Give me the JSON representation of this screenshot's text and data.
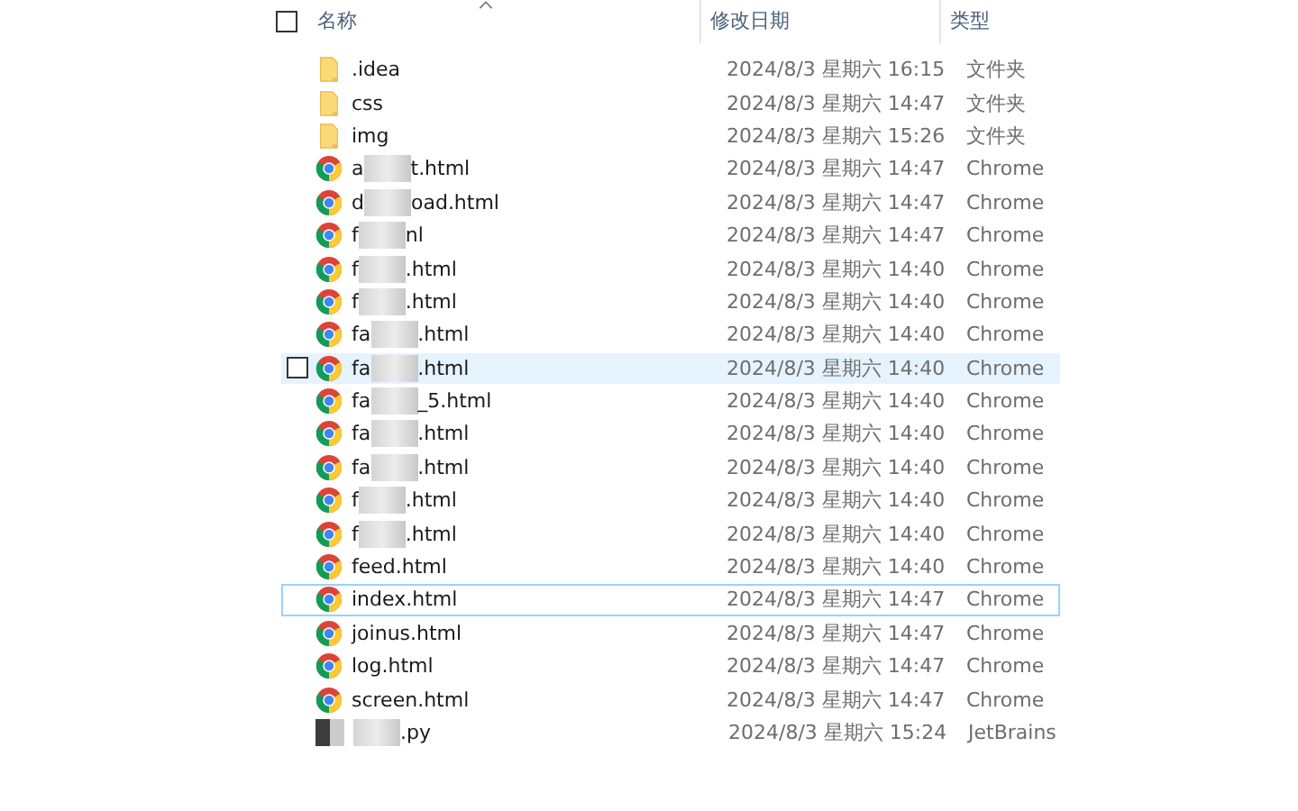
{
  "columns": [
    {
      "label": "名称"
    },
    {
      "label": "修改日期"
    },
    {
      "label": "类型"
    }
  ],
  "header_checked": false,
  "rows": [
    {
      "kind": "folder",
      "name": ".idea",
      "date": "2024/8/3 星期六 16:15",
      "type": "文件夹",
      "hovered": false,
      "focused": false
    },
    {
      "kind": "folder",
      "name": "css",
      "date": "2024/8/3 星期六 14:47",
      "type": "文件夹",
      "hovered": false,
      "focused": false
    },
    {
      "kind": "folder",
      "name": "img",
      "date": "2024/8/3 星期六 15:26",
      "type": "文件夹",
      "hovered": false,
      "focused": false
    },
    {
      "kind": "chrome",
      "name_start": "a",
      "name_end": "t.html",
      "date": "2024/8/3 星期六 14:47",
      "type": "Chrome",
      "hovered": false,
      "focused": false
    },
    {
      "kind": "chrome",
      "name_start": "d",
      "name_end": "oad.html",
      "date": "2024/8/3 星期六 14:47",
      "type": "Chrome",
      "hovered": false,
      "focused": false
    },
    {
      "kind": "chrome",
      "name_start": "f",
      "name_end": "nl",
      "date": "2024/8/3 星期六 14:47",
      "type": "Chrome",
      "hovered": false,
      "focused": false
    },
    {
      "kind": "chrome",
      "name_start": "f",
      "name_end": ".html",
      "date": "2024/8/3 星期六 14:40",
      "type": "Chrome",
      "hovered": false,
      "focused": false
    },
    {
      "kind": "chrome",
      "name_start": "f",
      "name_end": ".html",
      "date": "2024/8/3 星期六 14:40",
      "type": "Chrome",
      "hovered": false,
      "focused": false
    },
    {
      "kind": "chrome",
      "name_start": "fa",
      "name_end": ".html",
      "date": "2024/8/3 星期六 14:40",
      "type": "Chrome",
      "hovered": false,
      "focused": false
    },
    {
      "kind": "chrome",
      "name_start": "fa",
      "name_end": ".html",
      "date": "2024/8/3 星期六 14:40",
      "type": "Chrome",
      "hovered": true,
      "focused": false
    },
    {
      "kind": "chrome",
      "name_start": "fa",
      "name_end": "_5.html",
      "date": "2024/8/3 星期六 14:40",
      "type": "Chrome",
      "hovered": false,
      "focused": false
    },
    {
      "kind": "chrome",
      "name_start": "fa",
      "name_end": ".html",
      "date": "2024/8/3 星期六 14:40",
      "type": "Chrome",
      "hovered": false,
      "focused": false
    },
    {
      "kind": "chrome",
      "name_start": "fa",
      "name_end": ".html",
      "date": "2024/8/3 星期六 14:40",
      "type": "Chrome",
      "hovered": false,
      "focused": false
    },
    {
      "kind": "chrome",
      "name_start": "f",
      "name_end": ".html",
      "date": "2024/8/3 星期六 14:40",
      "type": "Chrome",
      "hovered": false,
      "focused": false
    },
    {
      "kind": "chrome",
      "name_start": "f",
      "name_end": ".html",
      "date": "2024/8/3 星期六 14:40",
      "type": "Chrome",
      "hovered": false,
      "focused": false
    },
    {
      "kind": "chrome",
      "name": "feed.html",
      "date": "2024/8/3 星期六 14:40",
      "type": "Chrome",
      "hovered": false,
      "focused": false
    },
    {
      "kind": "chrome",
      "name": "index.html",
      "date": "2024/8/3 星期六 14:47",
      "type": "Chrome",
      "hovered": false,
      "focused": true
    },
    {
      "kind": "chrome",
      "name": "joinus.html",
      "date": "2024/8/3 星期六 14:47",
      "type": "Chrome",
      "hovered": false,
      "focused": false
    },
    {
      "kind": "chrome",
      "name": "log.html",
      "date": "2024/8/3 星期六 14:47",
      "type": "Chrome",
      "hovered": false,
      "focused": false
    },
    {
      "kind": "chrome",
      "name": "screen.html",
      "date": "2024/8/3 星期六 14:47",
      "type": "Chrome",
      "hovered": false,
      "focused": false
    },
    {
      "kind": "redacted",
      "name_end": ".py",
      "date": "2024/8/3 星期六 15:24",
      "type": "JetBrains",
      "hovered": false,
      "focused": false
    }
  ]
}
